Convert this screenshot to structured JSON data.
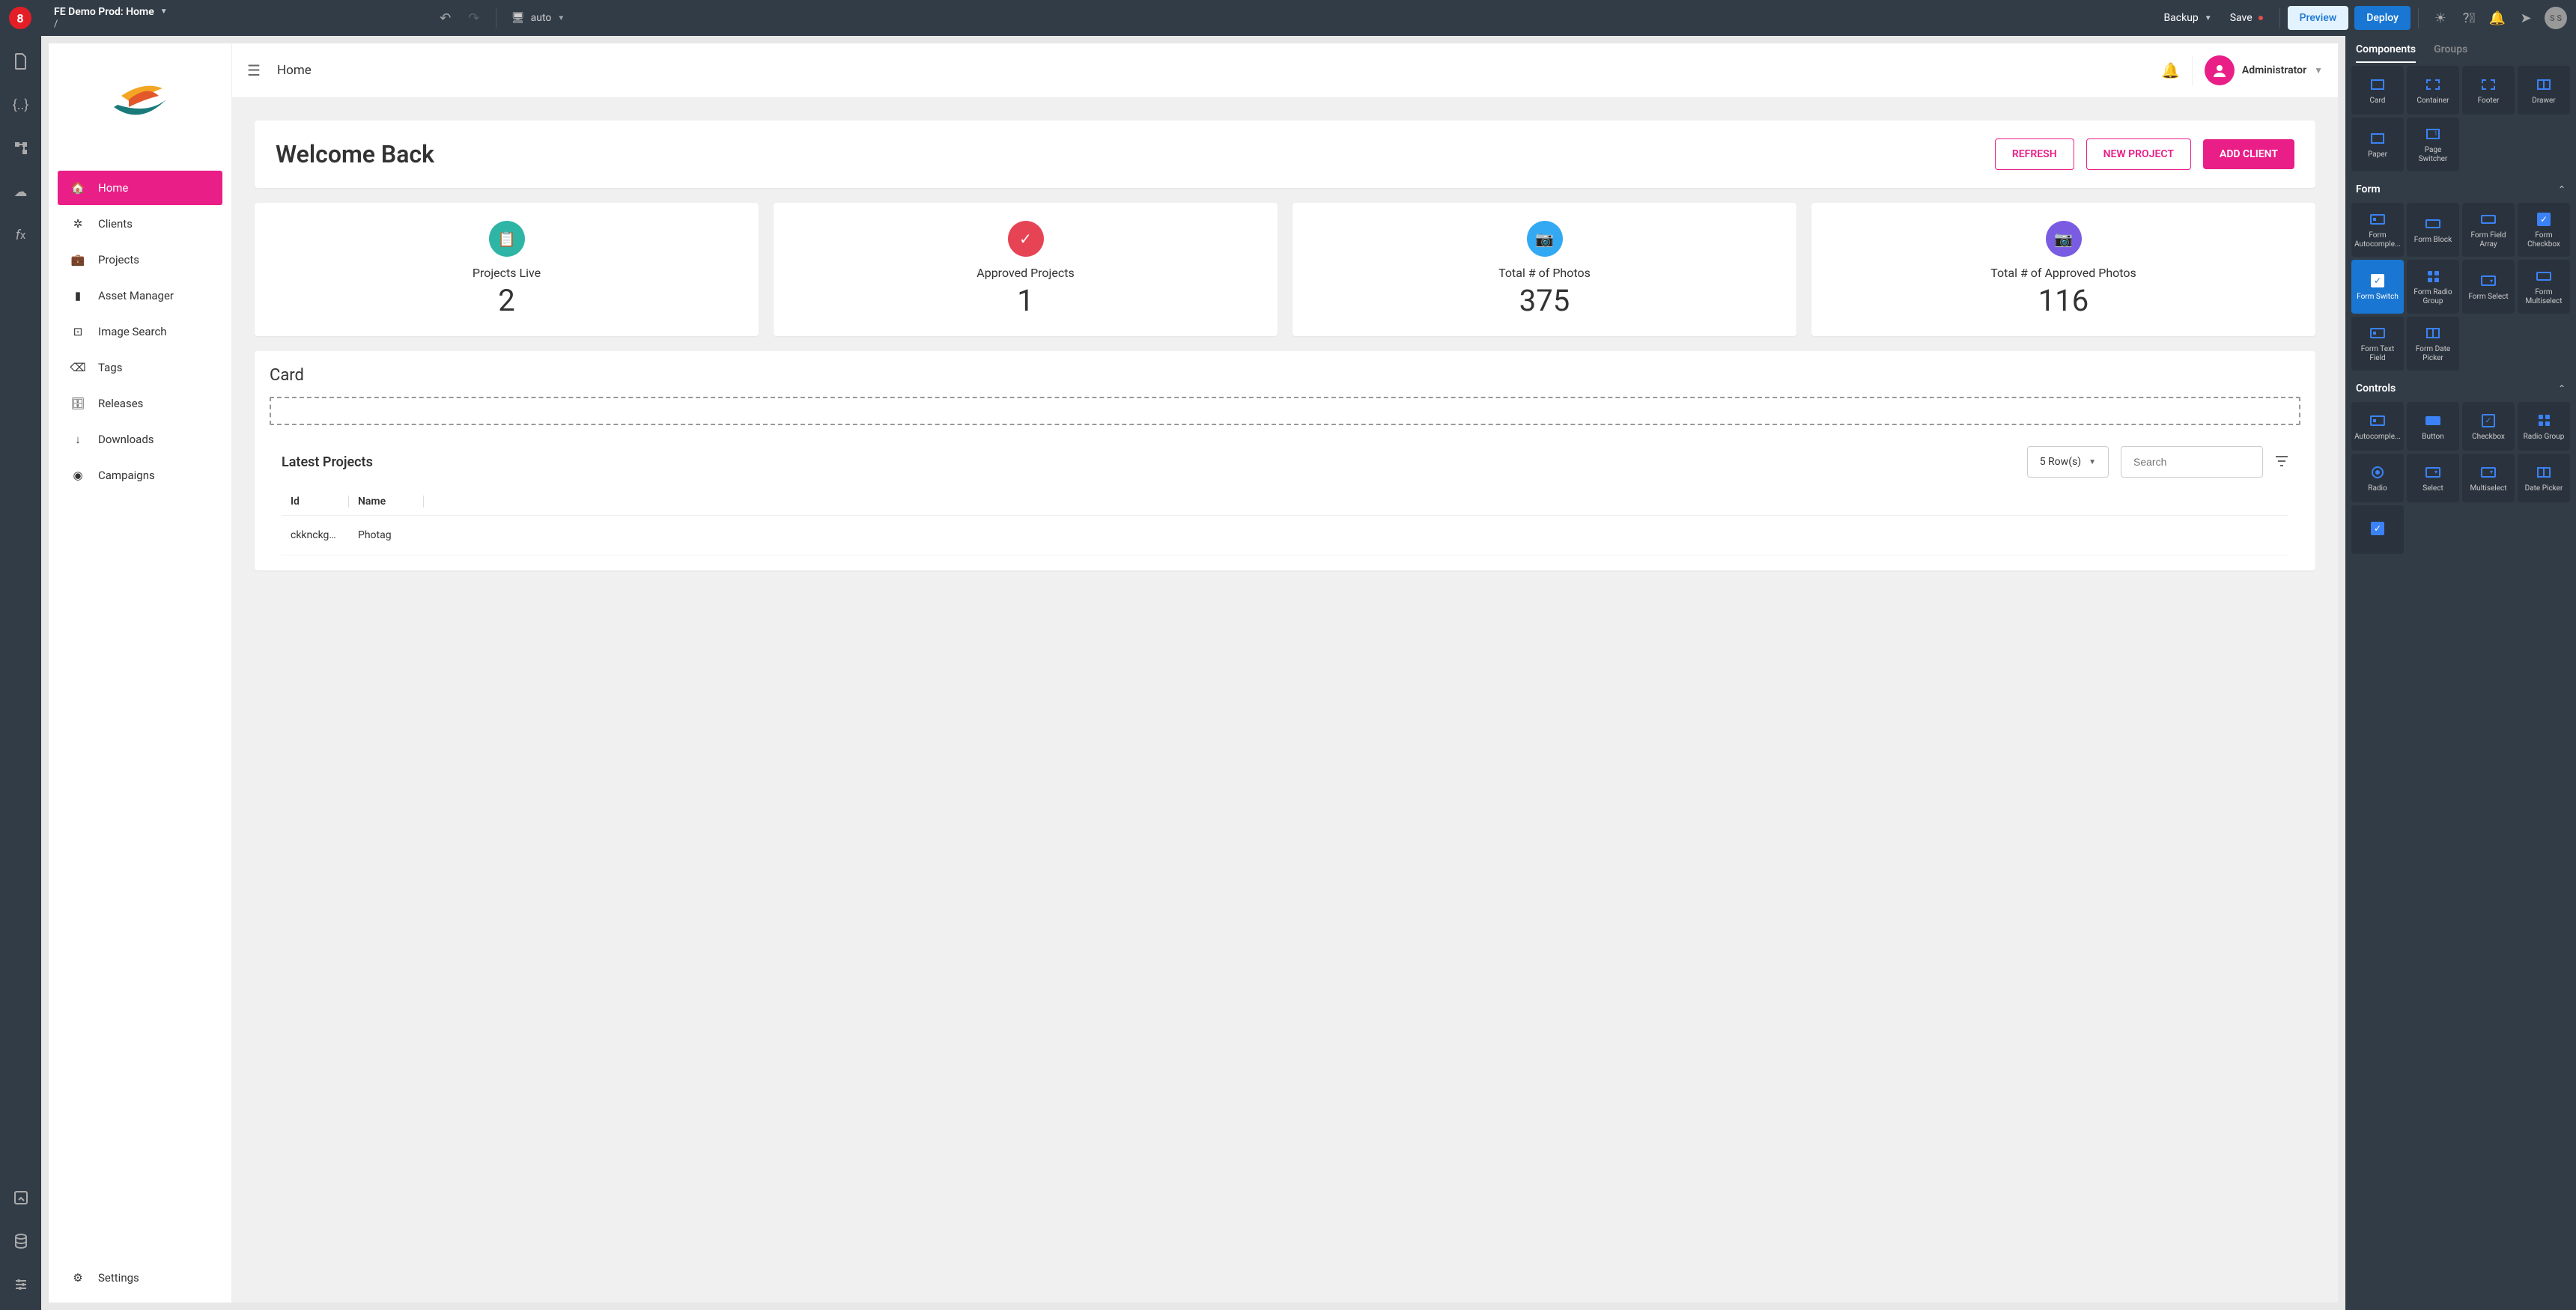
{
  "topbar": {
    "logo": "8",
    "title": "FE Demo Prod: Home",
    "subtitle": "/",
    "device_mode": "auto",
    "backup_label": "Backup",
    "save_label": "Save",
    "preview_label": "Preview",
    "deploy_label": "Deploy",
    "avatar_initials": "S S"
  },
  "canvas": {
    "app_header": {
      "title": "Home",
      "user_label": "Administrator"
    },
    "sidebar": {
      "items": [
        {
          "label": "Home"
        },
        {
          "label": "Clients"
        },
        {
          "label": "Projects"
        },
        {
          "label": "Asset Manager"
        },
        {
          "label": "Image Search"
        },
        {
          "label": "Tags"
        },
        {
          "label": "Releases"
        },
        {
          "label": "Downloads"
        },
        {
          "label": "Campaigns"
        }
      ],
      "settings_label": "Settings"
    },
    "welcome": {
      "title": "Welcome Back",
      "refresh_label": "REFRESH",
      "new_project_label": "NEW PROJECT",
      "add_client_label": "ADD CLIENT"
    },
    "stats": [
      {
        "label": "Projects Live",
        "value": "2"
      },
      {
        "label": "Approved Projects",
        "value": "1"
      },
      {
        "label": "Total # of Photos",
        "value": "375"
      },
      {
        "label": "Total # of Approved Photos",
        "value": "116"
      }
    ],
    "card_label": "Card",
    "table": {
      "title": "Latest Projects",
      "rows_select": "5 Row(s)",
      "search_placeholder": "Search",
      "columns": [
        "Id",
        "Name"
      ],
      "rows": [
        {
          "id": "ckknckgn6...",
          "name": "Photag"
        }
      ]
    }
  },
  "rightpanel": {
    "tabs": {
      "components": "Components",
      "groups": "Groups"
    },
    "layout_items": [
      {
        "label": "Card"
      },
      {
        "label": "Container"
      },
      {
        "label": "Footer"
      },
      {
        "label": "Drawer"
      },
      {
        "label": "Paper"
      },
      {
        "label": "Page Switcher"
      }
    ],
    "form_section": "Form",
    "form_items": [
      {
        "label": "Form Autocomple..."
      },
      {
        "label": "Form Block"
      },
      {
        "label": "Form Field Array"
      },
      {
        "label": "Form Checkbox"
      },
      {
        "label": "Form Switch"
      },
      {
        "label": "Form Radio Group"
      },
      {
        "label": "Form Select"
      },
      {
        "label": "Form Multiselect"
      },
      {
        "label": "Form Text Field"
      },
      {
        "label": "Form Date Picker"
      }
    ],
    "controls_section": "Controls",
    "controls_items": [
      {
        "label": "Autocomple..."
      },
      {
        "label": "Button"
      },
      {
        "label": "Checkbox"
      },
      {
        "label": "Radio Group"
      },
      {
        "label": "Radio"
      },
      {
        "label": "Select"
      },
      {
        "label": "Multiselect"
      },
      {
        "label": "Date Picker"
      }
    ]
  }
}
